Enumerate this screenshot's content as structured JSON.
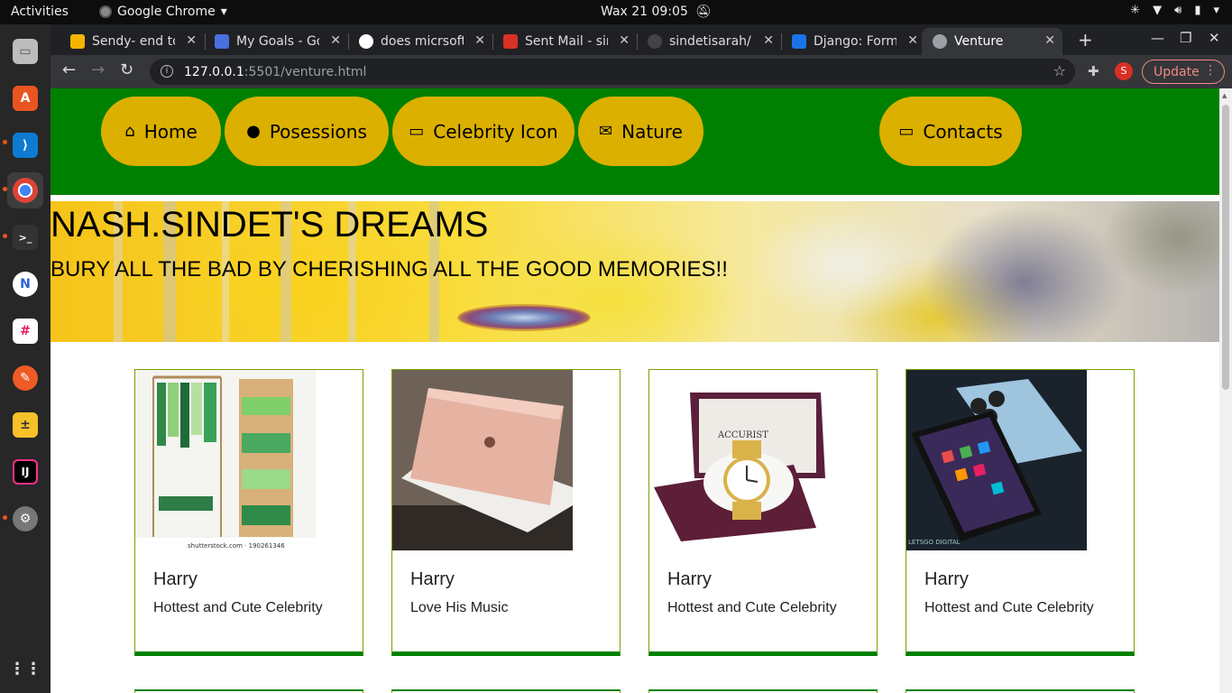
{
  "topbar": {
    "activities": "Activities",
    "app_name": "Google Chrome",
    "datetime": "Wax 21  09:05"
  },
  "dock": {
    "apps": [
      "files-icon",
      "ubuntu-software-icon",
      "vscode-icon",
      "chrome-icon",
      "terminal-icon",
      "app-icon",
      "slack-icon",
      "postman-icon",
      "calculator-icon",
      "intellij-icon",
      "settings-icon",
      "show-apps-icon"
    ]
  },
  "browser": {
    "tabs": [
      {
        "title": "Sendy- end to",
        "color": "#f5b400"
      },
      {
        "title": "My Goals - Goo",
        "color": "#4a6fe0"
      },
      {
        "title": "does micrsoft",
        "color": "#ffffff"
      },
      {
        "title": "Sent Mail - sin",
        "color": "#d93025"
      },
      {
        "title": "sindetisarah/",
        "color": "#ffffff"
      },
      {
        "title": "Django: Form",
        "color": "#1a73e8"
      },
      {
        "title": "Venture",
        "color": "#9aa0a6"
      }
    ],
    "url_host": "127.0.0.1",
    "url_path": ":5501/venture.html",
    "profile_initial": "S",
    "update_label": "Update"
  },
  "nav": {
    "items": [
      {
        "label": "Home",
        "icon": "home-icon"
      },
      {
        "label": "Posessions",
        "icon": "user-icon"
      },
      {
        "label": "Celebrity Icon",
        "icon": "laptop-icon"
      },
      {
        "label": "Nature",
        "icon": "envelope-icon"
      },
      {
        "label": "Contacts",
        "icon": "laptop-icon"
      }
    ],
    "bg_color": "#008000",
    "pill_color": "#dbb000"
  },
  "hero": {
    "title": "NASH.SINDET'S DREAMS",
    "subtitle": "BURY ALL THE BAD BY CHERISHING ALL THE GOOD MEMORIES!!"
  },
  "cards": [
    {
      "name": "Harry",
      "desc": "Hottest and Cute Celebrity",
      "image": "wardrobe-image",
      "caption": "shutterstock.com · 190261346"
    },
    {
      "name": "Harry",
      "desc": "Love His Music",
      "image": "laptop-image"
    },
    {
      "name": "Harry",
      "desc": "Hottest and Cute Celebrity",
      "image": "watch-image",
      "brand": "ACCURIST"
    },
    {
      "name": "Harry",
      "desc": "Hottest and Cute Celebrity",
      "image": "phone-image",
      "brand": "LETSGO DIGITAL"
    }
  ]
}
